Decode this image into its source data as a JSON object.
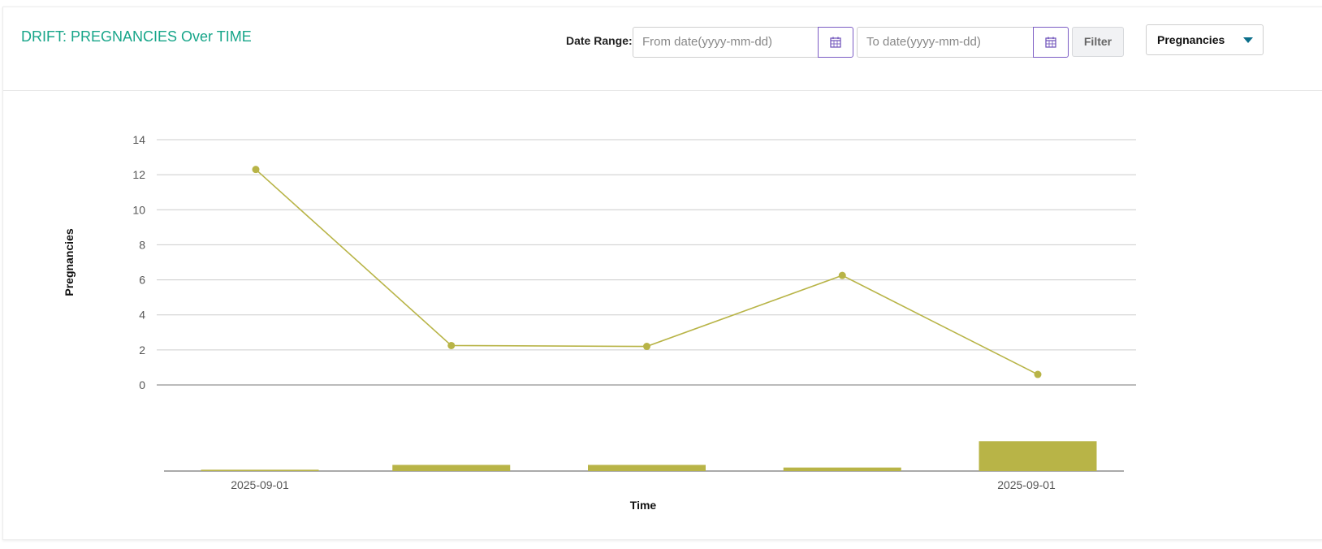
{
  "header": {
    "title": "DRIFT: PREGNANCIES Over TIME",
    "date_range_label": "Date Range:",
    "from_placeholder": "From date(yyyy-mm-dd)",
    "to_placeholder": "To date(yyyy-mm-dd)",
    "filter_label": "Filter",
    "feature_select_value": "Pregnancies",
    "accent_color": "#17a589"
  },
  "chart_data": {
    "type": "line",
    "ylabel": "Pregnancies",
    "xlabel": "Time",
    "ylim": [
      0,
      14
    ],
    "yticks": [
      0,
      2,
      4,
      6,
      8,
      10,
      12,
      14
    ],
    "grid": true,
    "series_color": "#b8b447",
    "series": [
      {
        "values": [
          12.3,
          2.25,
          2.2,
          6.25,
          0.6
        ]
      }
    ],
    "x_tick_labels": [
      "2025-09-01",
      "2025-09-01"
    ],
    "brush_bars": [
      0.15,
      0.7,
      0.7,
      0.4,
      3.4
    ]
  }
}
